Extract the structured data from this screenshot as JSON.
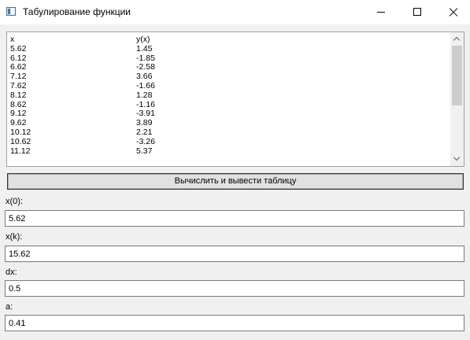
{
  "window": {
    "title": "Табулирование функции"
  },
  "table": {
    "header": {
      "x": "x",
      "y": "y(x)"
    },
    "rows": [
      {
        "x": "5.62",
        "y": "1.45"
      },
      {
        "x": "6.12",
        "y": "-1.85"
      },
      {
        "x": "6.62",
        "y": "-2.58"
      },
      {
        "x": "7.12",
        "y": "3.66"
      },
      {
        "x": "7.62",
        "y": "-1.66"
      },
      {
        "x": "8.12",
        "y": "1.28"
      },
      {
        "x": "8.62",
        "y": "-1.16"
      },
      {
        "x": "9.12",
        "y": "-3.91"
      },
      {
        "x": "9.62",
        "y": "3.89"
      },
      {
        "x": "10.12",
        "y": "2.21"
      },
      {
        "x": "10.62",
        "y": "-3.26"
      },
      {
        "x": "11.12",
        "y": "5.37"
      }
    ]
  },
  "action": {
    "compute_label": "Вычислить и вывести таблицу"
  },
  "fields": {
    "x0": {
      "label": "x(0):",
      "value": "5.62"
    },
    "xk": {
      "label": "x(k):",
      "value": "15.62"
    },
    "dx": {
      "label": "dx:",
      "value": "0.5"
    },
    "a": {
      "label": "a:",
      "value": "0.41"
    }
  }
}
